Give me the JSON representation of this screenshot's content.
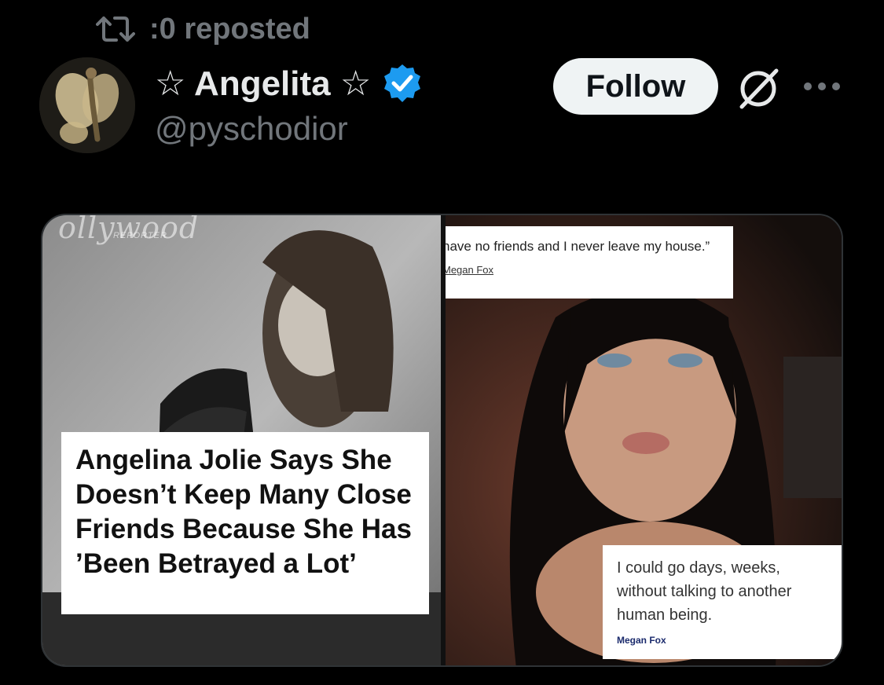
{
  "repost": {
    "text": ":0 reposted",
    "icon": "repost-icon"
  },
  "author": {
    "display_name": "☆ Angelita ☆",
    "handle": "@pyschodior",
    "verified": true,
    "avatar_icon": "fairy-avatar"
  },
  "actions": {
    "follow_label": "Follow",
    "grok_icon": "grok-icon",
    "more_icon": "more-icon"
  },
  "media": {
    "left": {
      "masthead": "ollywood",
      "masthead_sub": "REPORTER",
      "headline": "Angelina Jolie Says She Doesn’t Keep Many Close Friends Because She Has ’Been Betrayed a Lot’"
    },
    "right": {
      "top_quote": "have no friends and I never leave my house.”",
      "top_author": "Megan Fox",
      "bottom_quote": "I could go days, weeks, without talking to another human being.",
      "bottom_author": "Megan Fox"
    }
  },
  "colors": {
    "background": "#000000",
    "muted": "#71767b",
    "verified": "#1d9bf0",
    "follow_bg": "#eff3f4"
  }
}
